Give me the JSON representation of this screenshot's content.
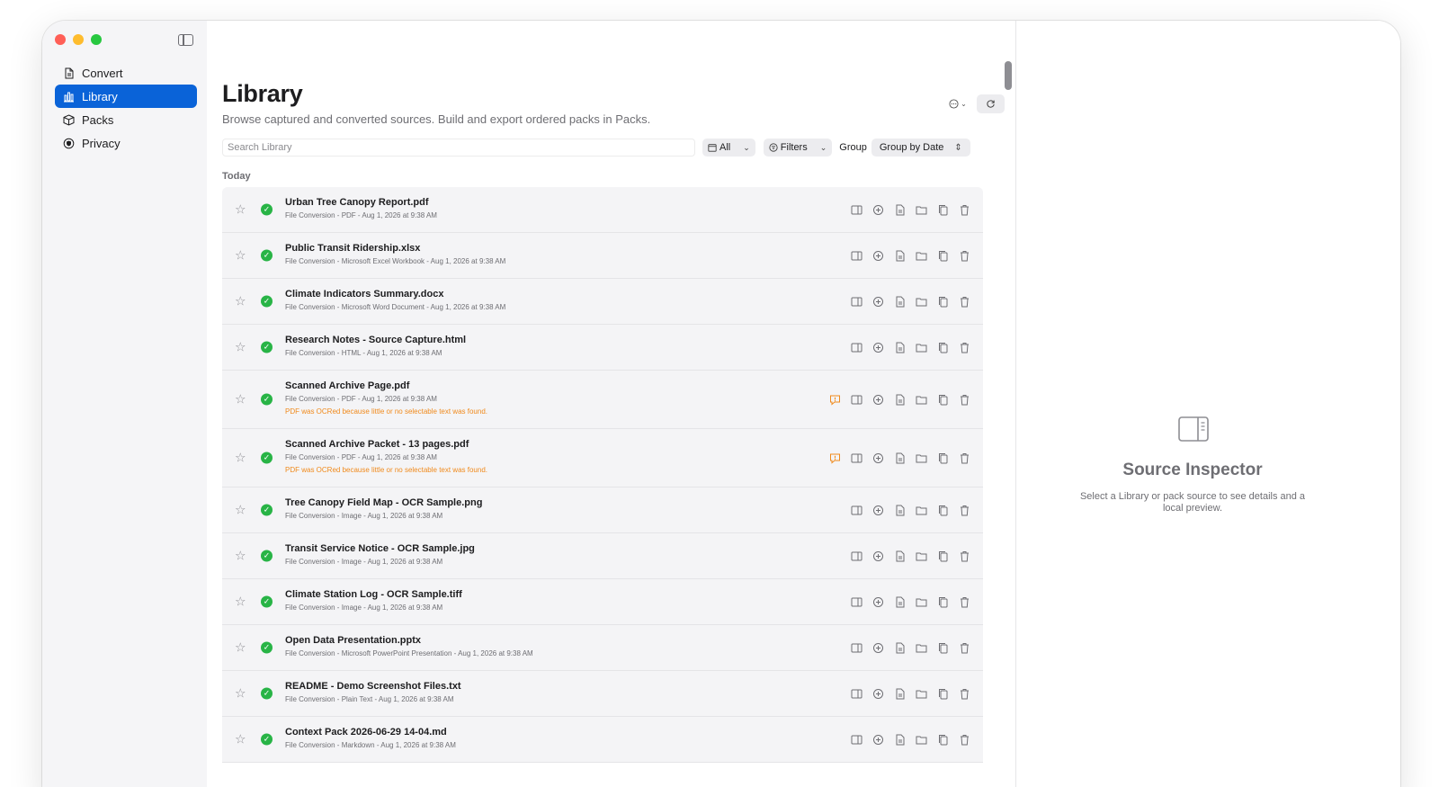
{
  "sidebar": {
    "items": [
      {
        "label": "Convert",
        "icon": "document-icon",
        "active": false
      },
      {
        "label": "Library",
        "icon": "chart-icon",
        "active": true
      },
      {
        "label": "Packs",
        "icon": "box-icon",
        "active": false
      },
      {
        "label": "Privacy",
        "icon": "shield-icon",
        "active": false
      }
    ]
  },
  "main": {
    "title": "Library",
    "subtitle": "Browse captured and converted sources. Build and export ordered packs in Packs.",
    "search_placeholder": "Search Library",
    "filter_all_label": "All",
    "filters_label": "Filters",
    "group_label": "Group",
    "group_value": "Group by Date",
    "section_label": "Today"
  },
  "rows": [
    {
      "name": "Urban Tree Canopy Report.pdf",
      "meta": "File Conversion - PDF - Aug 1, 2026 at 9:38 AM",
      "warning": ""
    },
    {
      "name": "Public Transit Ridership.xlsx",
      "meta": "File Conversion - Microsoft Excel Workbook - Aug 1, 2026 at 9:38 AM",
      "warning": ""
    },
    {
      "name": "Climate Indicators Summary.docx",
      "meta": "File Conversion - Microsoft Word Document - Aug 1, 2026 at 9:38 AM",
      "warning": ""
    },
    {
      "name": "Research Notes - Source Capture.html",
      "meta": "File Conversion - HTML - Aug 1, 2026 at 9:38 AM",
      "warning": ""
    },
    {
      "name": "Scanned Archive Page.pdf",
      "meta": "File Conversion - PDF - Aug 1, 2026 at 9:38 AM",
      "warning": "PDF was OCRed because little or no selectable text was found."
    },
    {
      "name": "Scanned Archive Packet - 13 pages.pdf",
      "meta": "File Conversion - PDF - Aug 1, 2026 at 9:38 AM",
      "warning": "PDF was OCRed because little or no selectable text was found."
    },
    {
      "name": "Tree Canopy Field Map - OCR Sample.png",
      "meta": "File Conversion - Image - Aug 1, 2026 at 9:38 AM",
      "warning": ""
    },
    {
      "name": "Transit Service Notice - OCR Sample.jpg",
      "meta": "File Conversion - Image - Aug 1, 2026 at 9:38 AM",
      "warning": ""
    },
    {
      "name": "Climate Station Log - OCR Sample.tiff",
      "meta": "File Conversion - Image - Aug 1, 2026 at 9:38 AM",
      "warning": ""
    },
    {
      "name": "Open Data Presentation.pptx",
      "meta": "File Conversion - Microsoft PowerPoint Presentation - Aug 1, 2026 at 9:38 AM",
      "warning": ""
    },
    {
      "name": "README - Demo Screenshot Files.txt",
      "meta": "File Conversion - Plain Text - Aug 1, 2026 at 9:38 AM",
      "warning": ""
    },
    {
      "name": "Context Pack 2026-06-29 14-04.md",
      "meta": "File Conversion - Markdown - Aug 1, 2026 at 9:38 AM",
      "warning": ""
    }
  ],
  "inspector": {
    "title": "Source Inspector",
    "text": "Select a Library or pack source to see details and a local preview."
  },
  "colors": {
    "accent": "#0a63d8",
    "success": "#28b446",
    "warning": "#f08a1c"
  }
}
